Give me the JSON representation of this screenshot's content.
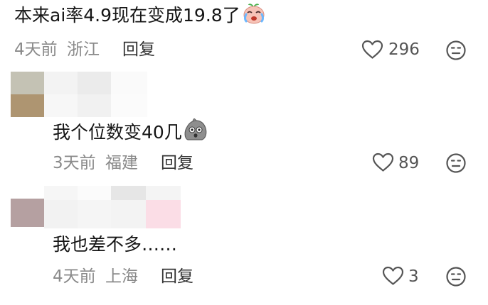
{
  "comments": [
    {
      "text": "本来ai率4.9现在变成19.8了",
      "emoji": "crying-face-emoji",
      "time": "4天前",
      "location": "浙江",
      "reply_label": "回复",
      "likes": "296"
    },
    {
      "text": "我个位数变40几",
      "emoji": "shocked-rock-emoji",
      "time": "3天前",
      "location": "福建",
      "reply_label": "回复",
      "likes": "89"
    },
    {
      "text": "我也差不多……",
      "time": "4天前",
      "location": "上海",
      "reply_label": "回复",
      "likes": "3"
    }
  ],
  "icons": {
    "like": "heart-icon",
    "dislike": "meh-face-icon"
  },
  "colors": {
    "meta_gray": "#8a8a8a",
    "icon_gray": "#555555",
    "text": "#161616"
  }
}
